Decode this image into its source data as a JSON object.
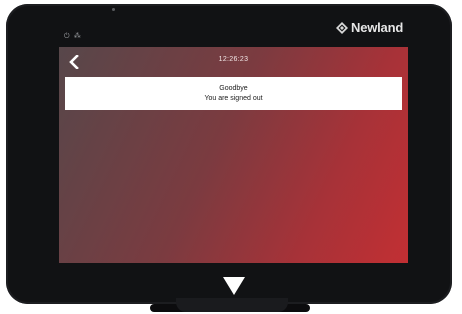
{
  "device": {
    "brand": "Newland",
    "brand_icon": "newland-logo-icon",
    "status_icons": "⏻ ⁂"
  },
  "screen": {
    "clock": "12:26:23",
    "back_icon": "chevron-left-icon",
    "message": {
      "title": "Goodbye",
      "body": "You are signed out"
    },
    "background": {
      "start": "#57474a",
      "end": "#c22f33"
    }
  },
  "hardware": {
    "home_icon": "triangle-down-icon"
  }
}
